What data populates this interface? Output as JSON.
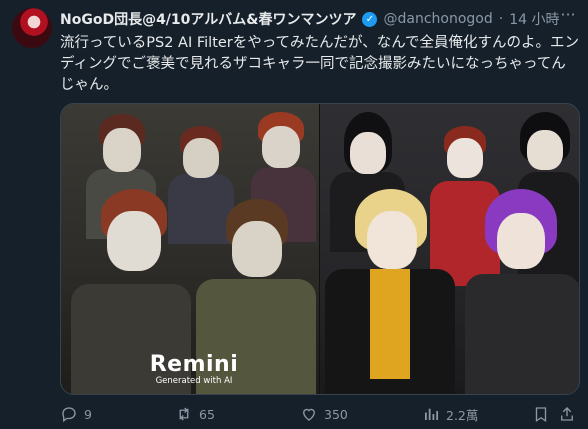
{
  "tweet": {
    "display_name": "NoGoD団長@4/10アルバム&春ワンマンツア",
    "verified_badge": "✓",
    "handle": "@danchonogod",
    "separator": "·",
    "time": "14 小時",
    "more_label": "···",
    "text": "流行っているPS2 AI Filterをやってみたんだが、なんで全員俺化すんのよ。エンディングでご褒美で見れるザコキャラ一同で記念撮影みたいになっちゃってんじゃん。"
  },
  "media": {
    "watermark_title": "Remini",
    "watermark_subtitle": "Generated with AI"
  },
  "actions": {
    "reply_count": "9",
    "retweet_count": "65",
    "like_count": "350",
    "view_count": "2.2萬"
  },
  "colors": {
    "background": "#15202b",
    "text": "#e7e9ea",
    "secondary": "#8b98a5",
    "verified": "#1d9bf0"
  }
}
